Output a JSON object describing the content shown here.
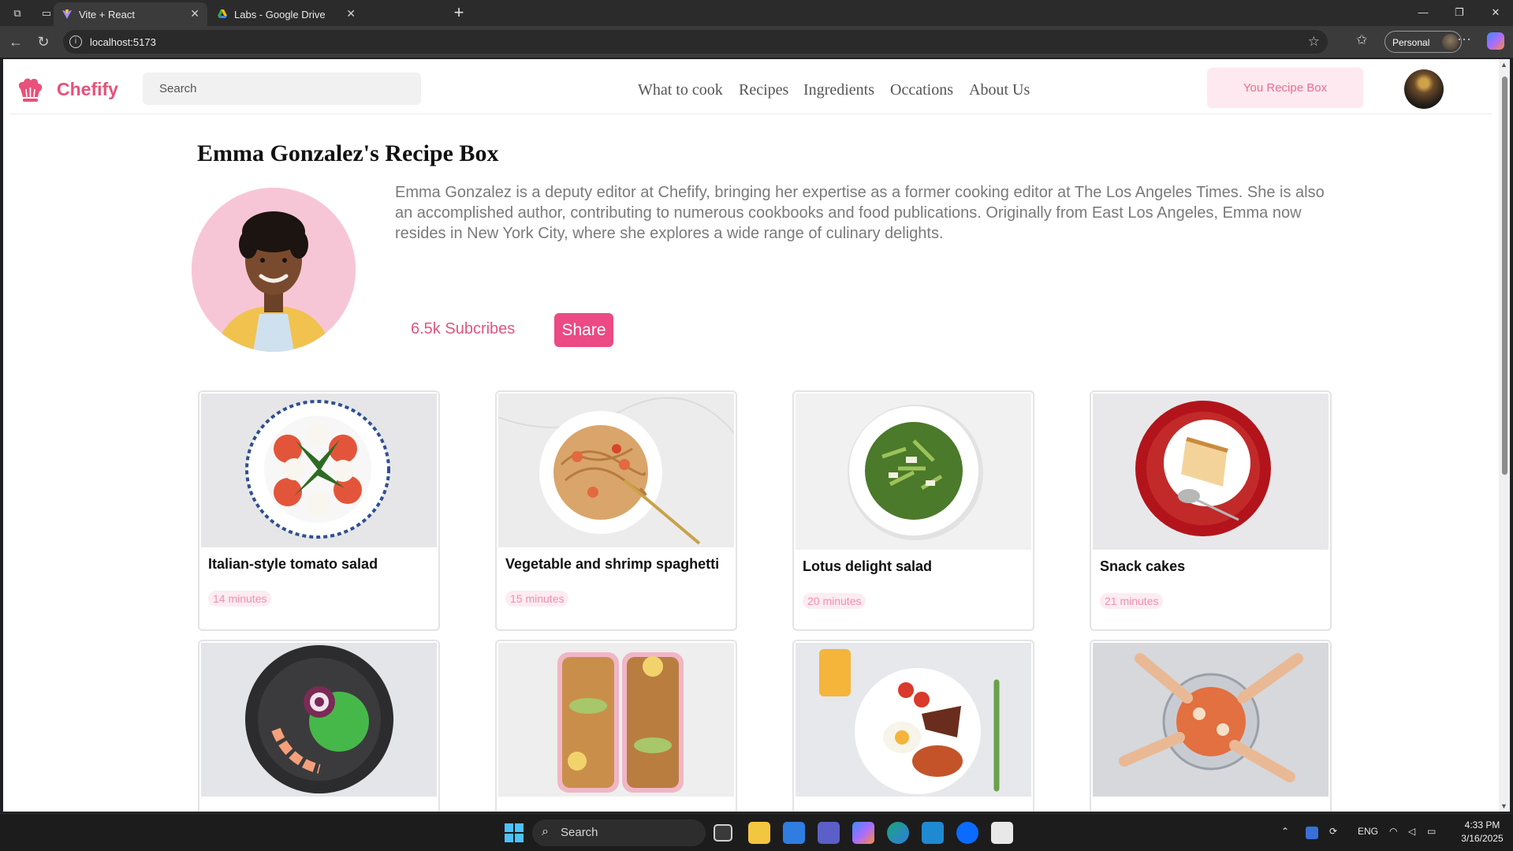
{
  "browser": {
    "tabs": [
      {
        "title": "Vite + React",
        "active": true
      },
      {
        "title": "Labs - Google Drive",
        "active": false
      }
    ],
    "url": "localhost:5173",
    "profile_label": "Personal"
  },
  "site": {
    "brand": "Chefify",
    "search_placeholder": "Search",
    "nav": [
      "What to cook",
      "Recipes",
      "Ingredients",
      "Occations",
      "About Us"
    ],
    "recipe_box_button": "You Recipe Box"
  },
  "profile": {
    "title": "Emma Gonzalez's Recipe Box",
    "bio": "Emma Gonzalez is a deputy editor at Chefify, bringing her expertise as a former cooking editor at The Los Angeles Times. She is also an accomplished author, contributing to numerous cookbooks and food publications. Originally from East Los Angeles, Emma now resides in New York City, where she explores a wide range of culinary delights.",
    "subscribers": "6.5k Subcribes",
    "share_label": "Share"
  },
  "recipes": [
    {
      "name": "Italian-style tomato salad",
      "time": "14 minutes"
    },
    {
      "name": "Vegetable and shrimp spaghetti",
      "time": "15 minutes"
    },
    {
      "name": "Lotus delight salad",
      "time": "20 minutes"
    },
    {
      "name": "Snack cakes",
      "time": "21 minutes"
    }
  ],
  "taskbar": {
    "search_label": "Search",
    "language": "ENG",
    "time": "4:33 PM",
    "date": "3/16/2025"
  },
  "colors": {
    "brand_pink": "#e8517a",
    "share_pink": "#ec4a84",
    "tag_bg": "#fdecf2"
  }
}
